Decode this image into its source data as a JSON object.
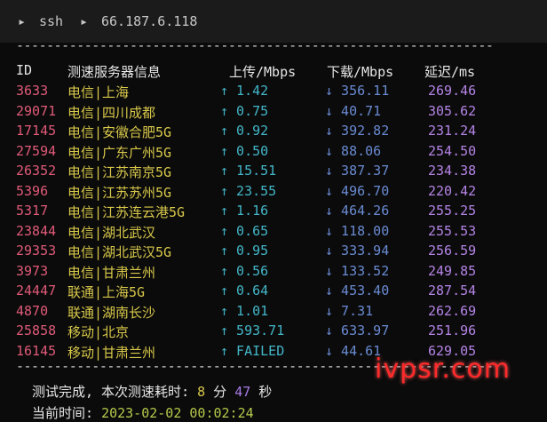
{
  "breadcrumb": {
    "item1": "ssh",
    "item2": "66.187.6.118"
  },
  "header": {
    "id": "ID",
    "node": "测速服务器信息",
    "upload": "上传/Mbps",
    "download": "下载/Mbps",
    "latency": "延迟/ms"
  },
  "rows": [
    {
      "id": "3633",
      "node": "电信|上海",
      "up": "↑ 1.42",
      "down": "↓ 356.11",
      "lat": "269.46"
    },
    {
      "id": "29071",
      "node": "电信|四川成都",
      "up": "↑ 0.75",
      "down": "↓ 40.71",
      "lat": "305.62"
    },
    {
      "id": "17145",
      "node": "电信|安徽合肥5G",
      "up": "↑ 0.92",
      "down": "↓ 392.82",
      "lat": "231.24"
    },
    {
      "id": "27594",
      "node": "电信|广东广州5G",
      "up": "↑ 0.50",
      "down": "↓ 88.06",
      "lat": "254.50"
    },
    {
      "id": "26352",
      "node": "电信|江苏南京5G",
      "up": "↑ 15.51",
      "down": "↓ 387.37",
      "lat": "234.38"
    },
    {
      "id": "5396",
      "node": "电信|江苏苏州5G",
      "up": "↑ 23.55",
      "down": "↓ 496.70",
      "lat": "220.42"
    },
    {
      "id": "5317",
      "node": "电信|江苏连云港5G",
      "up": "↑ 1.16",
      "down": "↓ 464.26",
      "lat": "255.25"
    },
    {
      "id": "23844",
      "node": "电信|湖北武汉",
      "up": "↑ 0.65",
      "down": "↓ 118.00",
      "lat": "255.53"
    },
    {
      "id": "29353",
      "node": "电信|湖北武汉5G",
      "up": "↑ 0.95",
      "down": "↓ 333.94",
      "lat": "256.59"
    },
    {
      "id": "3973",
      "node": "电信|甘肃兰州",
      "up": "↑ 0.56",
      "down": "↓ 133.52",
      "lat": "249.85"
    },
    {
      "id": "24447",
      "node": "联通|上海5G",
      "up": "↑ 0.64",
      "down": "↓ 453.40",
      "lat": "287.54"
    },
    {
      "id": "4870",
      "node": "联通|湖南长沙",
      "up": "↑ 1.01",
      "down": "↓ 7.31",
      "lat": "262.69"
    },
    {
      "id": "25858",
      "node": "移动|北京",
      "up": "↑ 593.71",
      "down": "↓ 633.97",
      "lat": "251.96"
    },
    {
      "id": "16145",
      "node": "移动|甘肃兰州",
      "up": "↑ FAILED",
      "down": "↓ 44.61",
      "lat": "629.05"
    }
  ],
  "footer": {
    "done_prefix": "测试完成, 本次测速耗时: ",
    "minutes": "8",
    "min_unit": " 分 ",
    "seconds": "47",
    "sec_unit": " 秒",
    "time_label": "当前时间: ",
    "time_value": "2023-02-02 00:02:24"
  },
  "watermark": "ivpsr.com"
}
